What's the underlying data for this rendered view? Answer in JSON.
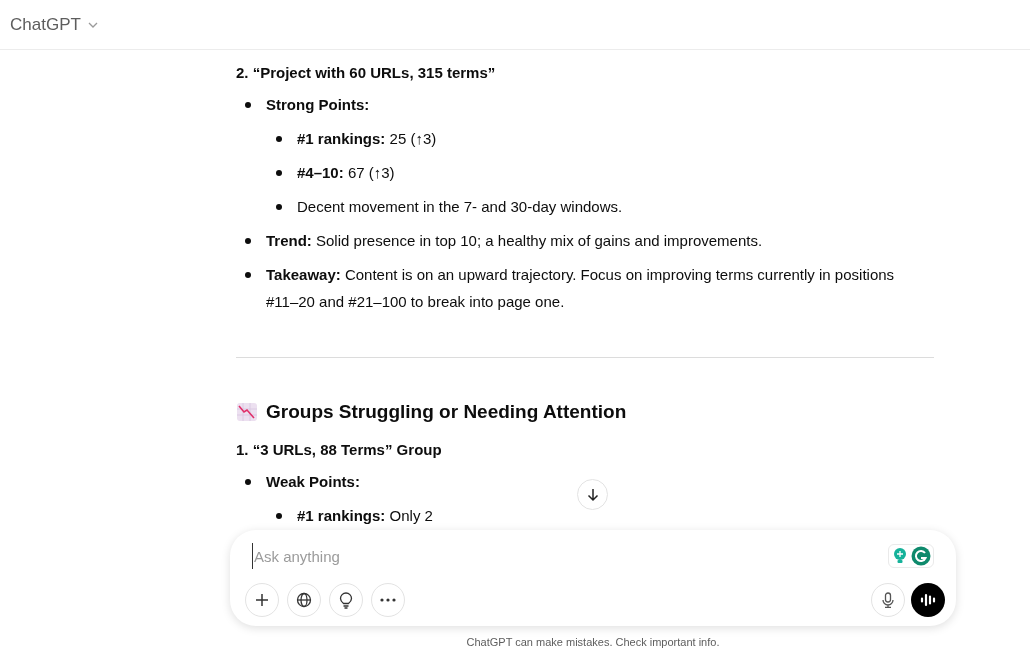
{
  "header": {
    "title": "ChatGPT"
  },
  "content": [
    {
      "kind": "title",
      "text": "2. “Project with 60 URLs, 315 terms”"
    },
    {
      "kind": "list",
      "items": [
        {
          "label": "Strong Points:",
          "children": [
            {
              "label": "#1 rankings:",
              "text": "25 (↑3)"
            },
            {
              "label": "#4–10:",
              "text": "67 (↑3)"
            },
            {
              "text": "Decent movement in the 7- and 30-day windows."
            }
          ]
        },
        {
          "label": "Trend:",
          "text": "Solid presence in top 10; a healthy mix of gains and improvements."
        },
        {
          "label": "Takeaway:",
          "text": "Content is on an upward trajectory. Focus on improving terms currently in positions #11–20 and #21–100 to break into page one."
        }
      ]
    },
    {
      "kind": "rule"
    },
    {
      "kind": "section_heading",
      "text": "Groups Struggling or Needing Attention"
    },
    {
      "kind": "title",
      "text": "1. “3 URLs, 88 Terms” Group"
    },
    {
      "kind": "list",
      "items": [
        {
          "label": "Weak Points:",
          "children": [
            {
              "label": "#1 rankings:",
              "text": "Only 2"
            }
          ]
        }
      ]
    }
  ],
  "composer": {
    "placeholder": "Ask anything"
  },
  "disclaimer": "ChatGPT can make mistakes. Check important info."
}
